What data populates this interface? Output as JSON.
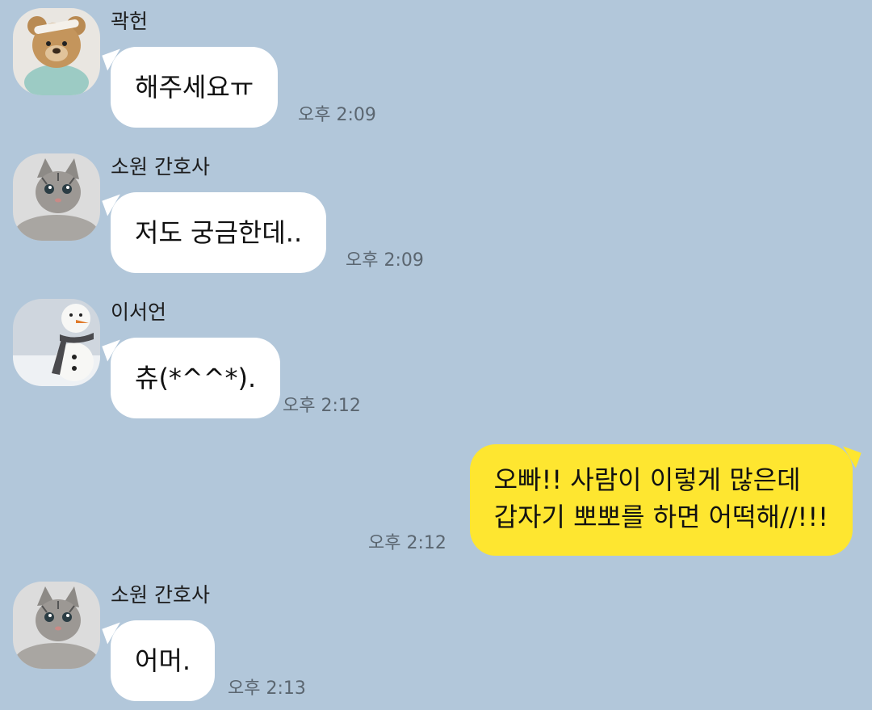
{
  "colors": {
    "background": "#b2c7da",
    "incoming_bubble": "#ffffff",
    "outgoing_bubble": "#fee630"
  },
  "messages": [
    {
      "sender": "곽헌",
      "avatar": "teddy-bear-avatar",
      "text": "해주세요ㅠ",
      "time": "오후 2:09"
    },
    {
      "sender": "소원 간호사",
      "avatar": "kitten-avatar",
      "text": "저도 궁금한데..",
      "time": "오후 2:09"
    },
    {
      "sender": "이서언",
      "avatar": "snowman-avatar",
      "text": "츄(*^^*).",
      "time": "오후 2:12"
    },
    {
      "outgoing": true,
      "line1": "오빠!! 사람이 이렇게 많은데",
      "line2": "갑자기 뽀뽀를 하면 어떡해//!!!",
      "time": "오후 2:12"
    },
    {
      "sender": "소원 간호사",
      "avatar": "kitten-avatar",
      "text": "어머.",
      "time": "오후 2:13"
    }
  ]
}
